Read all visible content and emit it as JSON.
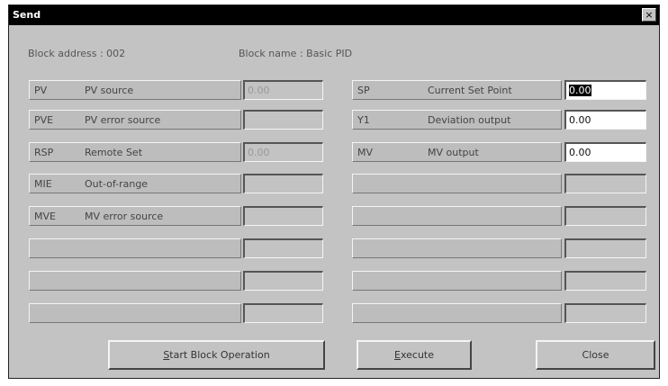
{
  "window": {
    "title": "Send",
    "close_glyph": "×"
  },
  "header": {
    "block_address": "Block address : 002",
    "block_name": "Block name : Basic PID"
  },
  "left_rows": [
    {
      "code": "PV",
      "description": "PV source",
      "value": "0.00"
    },
    {
      "code": "PVE",
      "description": "PV error source",
      "value": ""
    },
    {
      "code": "RSP",
      "description": "Remote Set",
      "value": "0.00"
    },
    {
      "code": "MIE",
      "description": "Out-of-range",
      "value": ""
    },
    {
      "code": "MVE",
      "description": "MV error source",
      "value": ""
    },
    {
      "code": "",
      "description": "",
      "value": ""
    },
    {
      "code": "",
      "description": "",
      "value": ""
    },
    {
      "code": "",
      "description": "",
      "value": ""
    }
  ],
  "right_rows": [
    {
      "code": "SP",
      "description": "Current Set Point",
      "value": "0.00"
    },
    {
      "code": "Y1",
      "description": "Deviation output",
      "value": "0.00"
    },
    {
      "code": "MV",
      "description": "MV output",
      "value": "0.00"
    },
    {
      "code": "",
      "description": "",
      "value": ""
    },
    {
      "code": "",
      "description": "",
      "value": ""
    },
    {
      "code": "",
      "description": "",
      "value": ""
    },
    {
      "code": "",
      "description": "",
      "value": ""
    },
    {
      "code": "",
      "description": "",
      "value": ""
    }
  ],
  "buttons": {
    "start": {
      "mnemonic": "S",
      "rest": "tart Block Operation"
    },
    "execute": {
      "mnemonic": "E",
      "rest": "xecute"
    },
    "close": {
      "label": "Close"
    }
  }
}
